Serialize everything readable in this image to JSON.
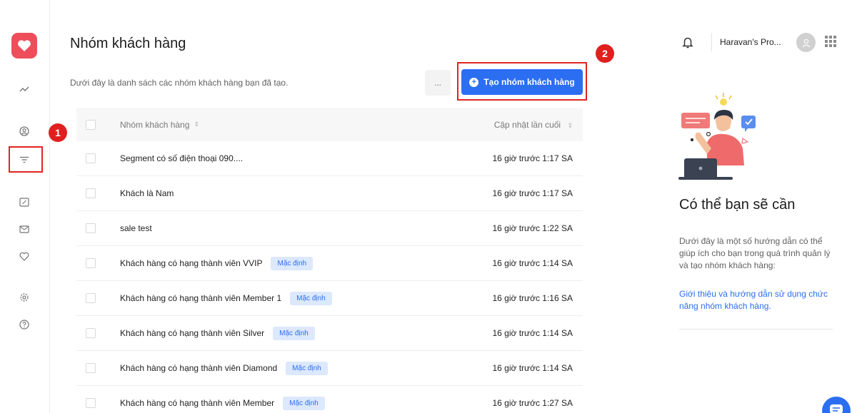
{
  "colors": {
    "accent": "#2b6ef2",
    "brand": "#ee4d5a",
    "highlight": "#e02424",
    "badge_bg": "#dce8fc"
  },
  "sidebar": {
    "icons": [
      "trend-icon",
      "user-circle-icon",
      "filter-icon",
      "discount-icon",
      "mail-icon",
      "heart-icon",
      "settings-icon",
      "help-icon"
    ]
  },
  "markers": {
    "one": "1",
    "two": "2"
  },
  "header": {
    "title": "Nhóm khách hàng",
    "description": "Dưới đây là danh sách các nhóm khách hàng bạn đã tạo.",
    "more_label": "...",
    "create_label": "Tạo nhóm khách hàng"
  },
  "table": {
    "columns": {
      "name": "Nhóm khách hàng",
      "updated": "Cập nhật lần cuối"
    },
    "rows": [
      {
        "name": "Segment có số điện thoại 090....",
        "badge": "",
        "updated": "16 giờ trước 1:17 SA"
      },
      {
        "name": "Khách là Nam",
        "badge": "",
        "updated": "16 giờ trước 1:17 SA"
      },
      {
        "name": "sale test",
        "badge": "",
        "updated": "16 giờ trước 1:22 SA"
      },
      {
        "name": "Khách hàng có hạng thành viên VVIP",
        "badge": "Mặc định",
        "updated": "16 giờ trước 1:14 SA"
      },
      {
        "name": "Khách hàng có hạng thành viên Member 1",
        "badge": "Mặc định",
        "updated": "16 giờ trước 1:16 SA"
      },
      {
        "name": "Khách hàng có hạng thành viên Silver",
        "badge": "Mặc định",
        "updated": "16 giờ trước 1:14 SA"
      },
      {
        "name": "Khách hàng có hạng thành viên Diamond",
        "badge": "Mặc định",
        "updated": "16 giờ trước 1:14 SA"
      },
      {
        "name": "Khách hàng có hạng thành viên Member",
        "badge": "Mặc định",
        "updated": "16 giờ trước 1:27 SA"
      }
    ]
  },
  "topbar": {
    "account": "Haravan's Pro..."
  },
  "help": {
    "title": "Có thể bạn sẽ cần",
    "description": "Dưới đây là một số hướng dẫn có thể giúp ích cho bạn trong quá trình quản lý và tạo nhóm khách hàng:",
    "link": "Giới thiệu và hướng dẫn sử dụng chức năng nhóm khách hàng."
  }
}
